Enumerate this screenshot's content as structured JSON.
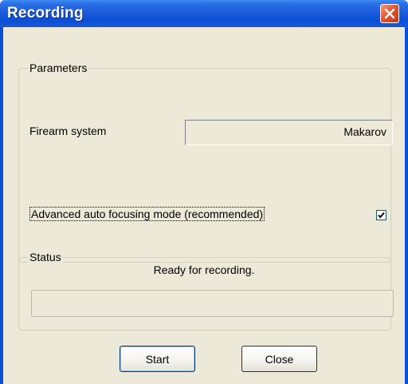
{
  "window": {
    "title": "Recording"
  },
  "parameters": {
    "group_label": "Parameters",
    "firearm_label": "Firearm system",
    "firearm_value": "Makarov",
    "autofocus_label": "Advanced auto focusing mode (recommended)",
    "autofocus_checked": true
  },
  "status": {
    "group_label": "Status",
    "message": "Ready for recording.",
    "progress": 0
  },
  "buttons": {
    "start_label": "Start",
    "close_label": "Close"
  },
  "icons": {
    "close": "close-icon",
    "checkmark": "checkmark-icon"
  },
  "colors": {
    "titlebar": "#0b4fd6",
    "dialog_bg": "#ece9d8",
    "close_button": "#e0522e"
  }
}
